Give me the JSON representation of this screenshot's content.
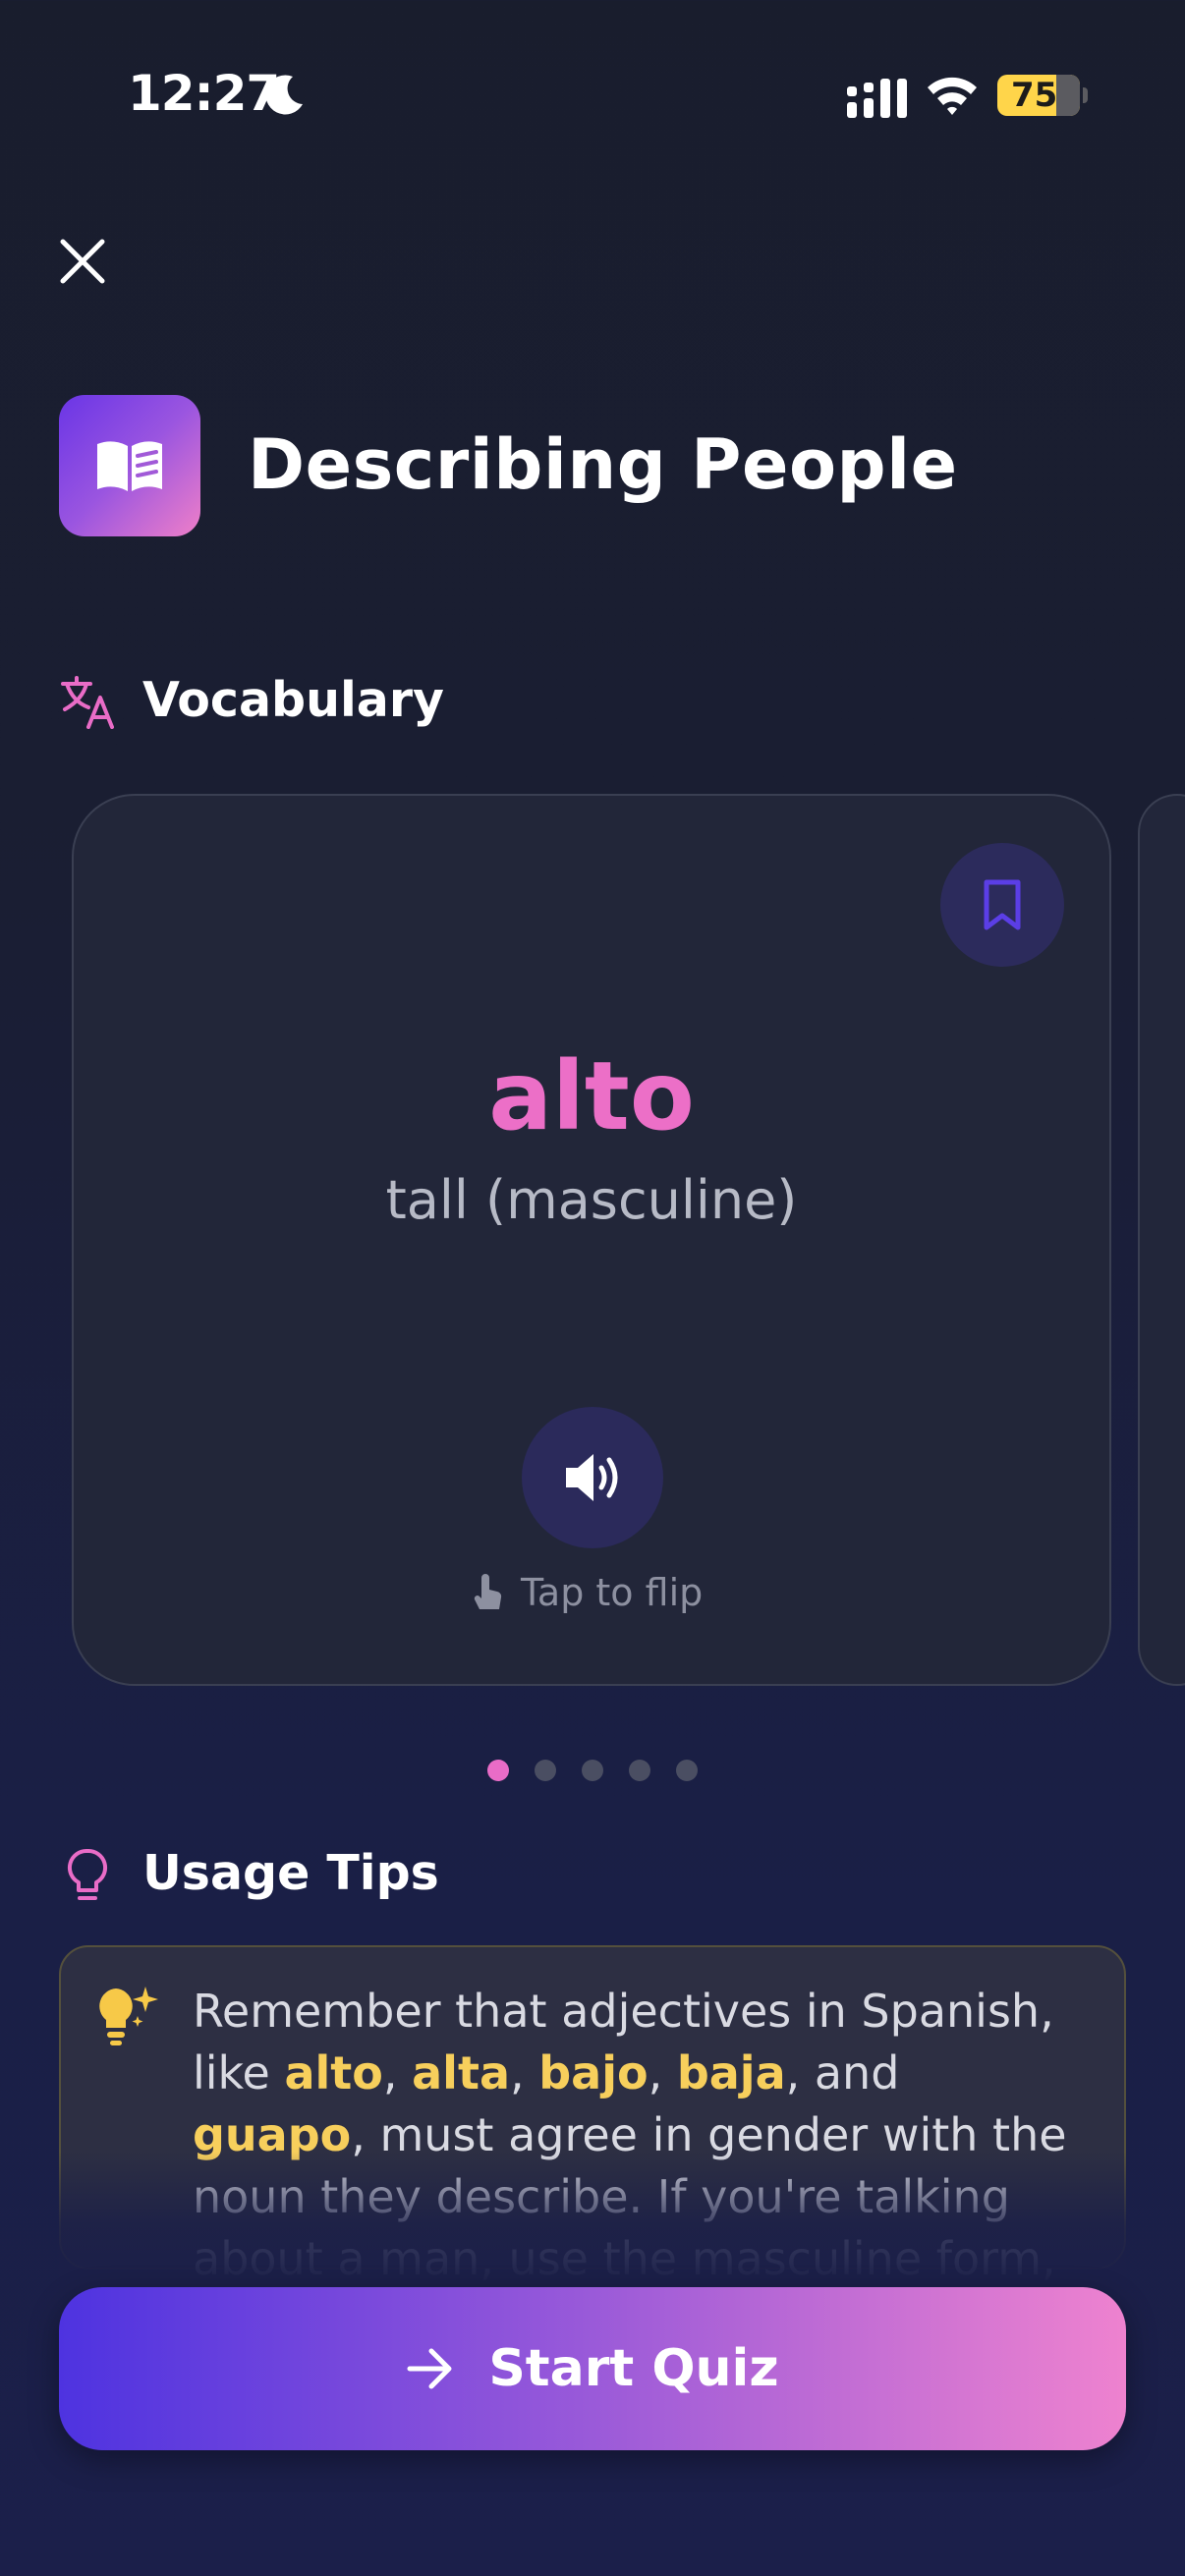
{
  "status_bar": {
    "time": "12:27",
    "battery": "75",
    "icons": [
      "moon-icon",
      "cellular-signal-icon",
      "wifi-icon",
      "battery-icon"
    ]
  },
  "header": {
    "close_icon": "close-icon",
    "title": "Describing People",
    "title_icon": "open-book-icon",
    "accent_gradient": [
      "#6a35e6",
      "#ef7fc8"
    ]
  },
  "vocabulary": {
    "section_label": "Vocabulary",
    "section_icon": "translate-icon",
    "card": {
      "word": "alto",
      "translation": "tall (masculine)",
      "hint": "Tap to flip",
      "bookmark_icon": "bookmark-icon",
      "audio_icon": "speaker-icon",
      "hint_icon": "tap-hand-icon"
    },
    "pagination": {
      "total": 5,
      "current": 1
    }
  },
  "tips": {
    "section_label": "Usage Tips",
    "section_icon": "lightbulb-icon",
    "card_icon": "sparkle-bulb-icon",
    "text_parts": [
      "Remember that adjectives in Spanish, like ",
      "alto",
      ", ",
      "alta",
      ", ",
      "bajo",
      ", ",
      "baja",
      ", and ",
      "guapo",
      ", must agree in gender with the noun they describe. If you're talking about a man, use the masculine form, and for a"
    ]
  },
  "footer": {
    "cta_label": "Start Quiz",
    "cta_icon": "arrow-right-icon"
  },
  "colors": {
    "accent_pink": "#ec6fc7",
    "highlight_yellow": "#f7cf5c",
    "background": "#1a1e33"
  }
}
